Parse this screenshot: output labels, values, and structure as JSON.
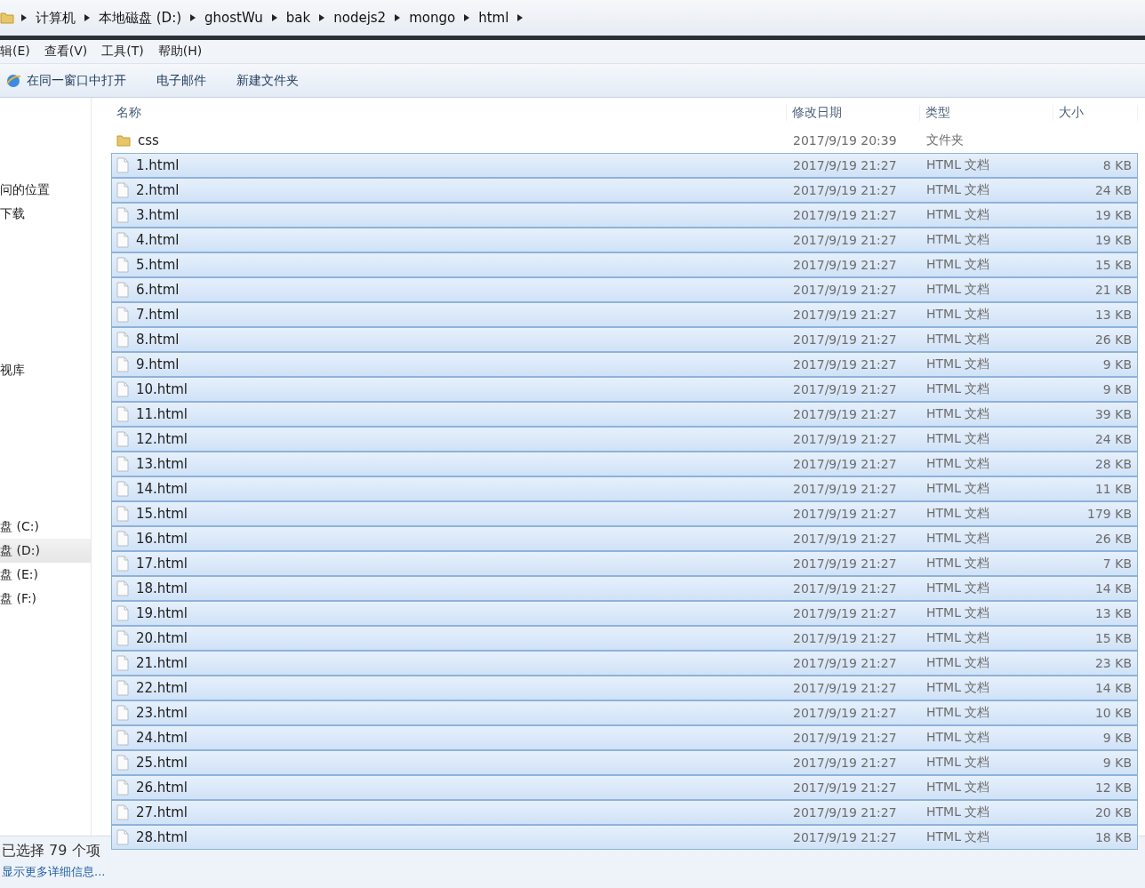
{
  "breadcrumb": [
    "计算机",
    "本地磁盘 (D:)",
    "ghostWu",
    "bak",
    "nodejs2",
    "mongo",
    "html"
  ],
  "menu": [
    "辑(E)",
    "查看(V)",
    "工具(T)",
    "帮助(H)"
  ],
  "toolbar": [
    {
      "label": "在同一窗口中打开",
      "kind": "browser"
    },
    {
      "label": "电子邮件",
      "kind": "plain"
    },
    {
      "label": "新建文件夹",
      "kind": "plain"
    }
  ],
  "sidebar": {
    "sections": [
      {
        "items": [
          {
            "label": "问的位置",
            "selected": false
          },
          {
            "label": "下载",
            "selected": false
          }
        ]
      },
      {
        "items": [
          {
            "label": "视库",
            "selected": false
          }
        ]
      },
      {
        "items": [
          {
            "label": "盘 (C:)",
            "selected": false
          },
          {
            "label": "盘 (D:)",
            "selected": true
          },
          {
            "label": "盘 (E:)",
            "selected": false
          },
          {
            "label": "盘 (F:)",
            "selected": false
          }
        ]
      }
    ]
  },
  "table": {
    "columns": [
      "名称",
      "修改日期",
      "类型",
      "大小"
    ],
    "rows": [
      {
        "kind": "folder",
        "name": "css",
        "date": "2017/9/19 20:39",
        "type": "文件夹",
        "selected": false
      },
      {
        "kind": "file",
        "name": "1.html",
        "date": "2017/9/19 21:27",
        "type": "HTML 文档",
        "size": "8 KB",
        "selected": true
      },
      {
        "kind": "file",
        "name": "2.html",
        "date": "2017/9/19 21:27",
        "type": "HTML 文档",
        "size": "24 KB",
        "selected": true
      },
      {
        "kind": "file",
        "name": "3.html",
        "date": "2017/9/19 21:27",
        "type": "HTML 文档",
        "size": "19 KB",
        "selected": true
      },
      {
        "kind": "file",
        "name": "4.html",
        "date": "2017/9/19 21:27",
        "type": "HTML 文档",
        "size": "19 KB",
        "selected": true
      },
      {
        "kind": "file",
        "name": "5.html",
        "date": "2017/9/19 21:27",
        "type": "HTML 文档",
        "size": "15 KB",
        "selected": true
      },
      {
        "kind": "file",
        "name": "6.html",
        "date": "2017/9/19 21:27",
        "type": "HTML 文档",
        "size": "21 KB",
        "selected": true
      },
      {
        "kind": "file",
        "name": "7.html",
        "date": "2017/9/19 21:27",
        "type": "HTML 文档",
        "size": "13 KB",
        "selected": true
      },
      {
        "kind": "file",
        "name": "8.html",
        "date": "2017/9/19 21:27",
        "type": "HTML 文档",
        "size": "26 KB",
        "selected": true
      },
      {
        "kind": "file",
        "name": "9.html",
        "date": "2017/9/19 21:27",
        "type": "HTML 文档",
        "size": "9 KB",
        "selected": true
      },
      {
        "kind": "file",
        "name": "10.html",
        "date": "2017/9/19 21:27",
        "type": "HTML 文档",
        "size": "9 KB",
        "selected": true
      },
      {
        "kind": "file",
        "name": "11.html",
        "date": "2017/9/19 21:27",
        "type": "HTML 文档",
        "size": "39 KB",
        "selected": true
      },
      {
        "kind": "file",
        "name": "12.html",
        "date": "2017/9/19 21:27",
        "type": "HTML 文档",
        "size": "24 KB",
        "selected": true
      },
      {
        "kind": "file",
        "name": "13.html",
        "date": "2017/9/19 21:27",
        "type": "HTML 文档",
        "size": "28 KB",
        "selected": true
      },
      {
        "kind": "file",
        "name": "14.html",
        "date": "2017/9/19 21:27",
        "type": "HTML 文档",
        "size": "11 KB",
        "selected": true
      },
      {
        "kind": "file",
        "name": "15.html",
        "date": "2017/9/19 21:27",
        "type": "HTML 文档",
        "size": "179 KB",
        "selected": true
      },
      {
        "kind": "file",
        "name": "16.html",
        "date": "2017/9/19 21:27",
        "type": "HTML 文档",
        "size": "26 KB",
        "selected": true
      },
      {
        "kind": "file",
        "name": "17.html",
        "date": "2017/9/19 21:27",
        "type": "HTML 文档",
        "size": "7 KB",
        "selected": true
      },
      {
        "kind": "file",
        "name": "18.html",
        "date": "2017/9/19 21:27",
        "type": "HTML 文档",
        "size": "14 KB",
        "selected": true
      },
      {
        "kind": "file",
        "name": "19.html",
        "date": "2017/9/19 21:27",
        "type": "HTML 文档",
        "size": "13 KB",
        "selected": true
      },
      {
        "kind": "file",
        "name": "20.html",
        "date": "2017/9/19 21:27",
        "type": "HTML 文档",
        "size": "15 KB",
        "selected": true
      },
      {
        "kind": "file",
        "name": "21.html",
        "date": "2017/9/19 21:27",
        "type": "HTML 文档",
        "size": "23 KB",
        "selected": true
      },
      {
        "kind": "file",
        "name": "22.html",
        "date": "2017/9/19 21:27",
        "type": "HTML 文档",
        "size": "14 KB",
        "selected": true
      },
      {
        "kind": "file",
        "name": "23.html",
        "date": "2017/9/19 21:27",
        "type": "HTML 文档",
        "size": "10 KB",
        "selected": true
      },
      {
        "kind": "file",
        "name": "24.html",
        "date": "2017/9/19 21:27",
        "type": "HTML 文档",
        "size": "9 KB",
        "selected": true
      },
      {
        "kind": "file",
        "name": "25.html",
        "date": "2017/9/19 21:27",
        "type": "HTML 文档",
        "size": "9 KB",
        "selected": true
      },
      {
        "kind": "file",
        "name": "26.html",
        "date": "2017/9/19 21:27",
        "type": "HTML 文档",
        "size": "12 KB",
        "selected": true
      },
      {
        "kind": "file",
        "name": "27.html",
        "date": "2017/9/19 21:27",
        "type": "HTML 文档",
        "size": "20 KB",
        "selected": true
      },
      {
        "kind": "file",
        "name": "28.html",
        "date": "2017/9/19 21:27",
        "type": "HTML 文档",
        "size": "18 KB",
        "selected": true
      }
    ]
  },
  "status_bar": {
    "summary": "已选择 79 个项",
    "details_link": "显示更多详细信息..."
  }
}
